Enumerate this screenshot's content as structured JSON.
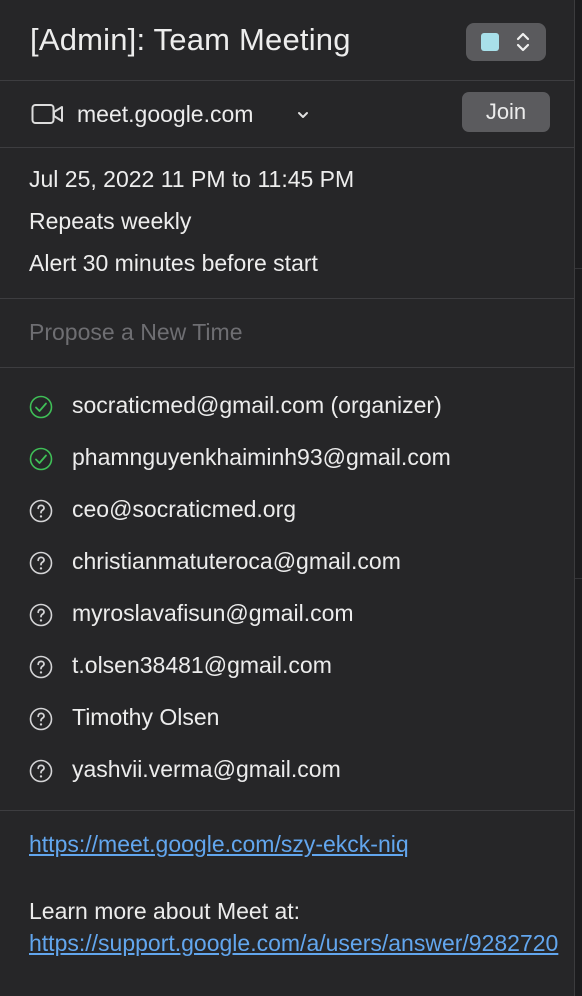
{
  "event": {
    "title": "[Admin]: Team Meeting",
    "calendar_color": "#a8e0ea"
  },
  "conference": {
    "icon": "video-camera-icon",
    "label": "meet.google.com",
    "join_label": "Join"
  },
  "schedule": {
    "datetime": "Jul 25, 2022  11 PM to 11:45 PM",
    "repeat": "Repeats weekly",
    "alert": "Alert 30 minutes before start"
  },
  "propose": {
    "label": "Propose a New Time"
  },
  "attendees": [
    {
      "name": "socraticmed@gmail.com (organizer)",
      "status": "accepted"
    },
    {
      "name": "phamnguyenkhaiminh93@gmail.com",
      "status": "accepted"
    },
    {
      "name": "ceo@socraticmed.org",
      "status": "unknown"
    },
    {
      "name": "christianmatuteroca@gmail.com",
      "status": "unknown"
    },
    {
      "name": "myroslavafisun@gmail.com",
      "status": "unknown"
    },
    {
      "name": "t.olsen38481@gmail.com",
      "status": "unknown"
    },
    {
      "name": "Timothy Olsen",
      "status": "unknown"
    },
    {
      "name": "yashvii.verma@gmail.com",
      "status": "unknown"
    }
  ],
  "notes": {
    "meet_link": "https://meet.google.com/szy-ekck-niq",
    "learn_prefix": "Learn more about Meet at: ",
    "learn_link": "https://support.google.com/a/users/answer/9282720"
  },
  "colors": {
    "accepted": "#3fbf57",
    "unknown": "#d4d4d6",
    "link": "#62a6ee"
  }
}
